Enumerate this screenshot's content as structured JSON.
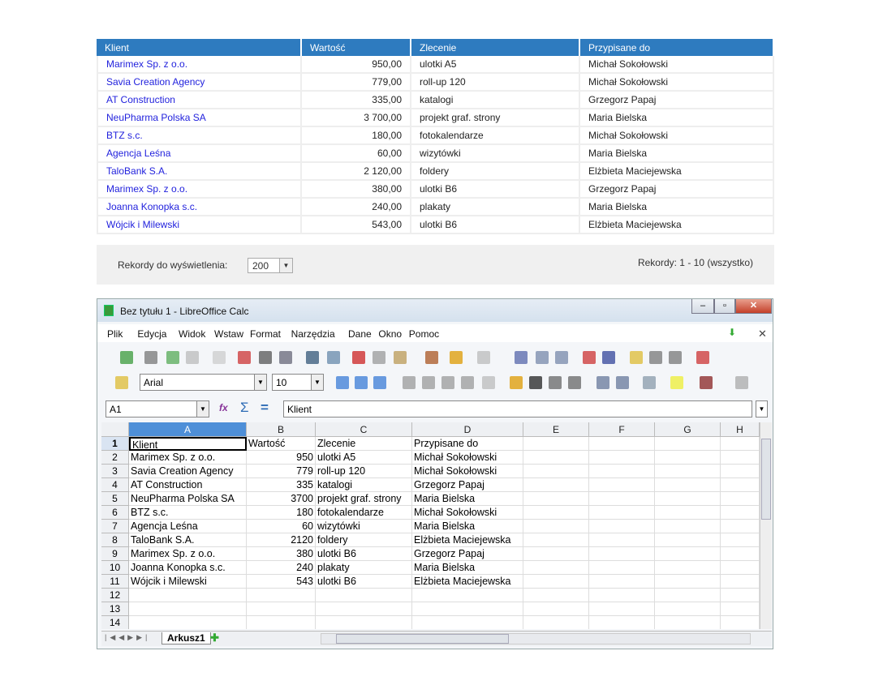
{
  "web_table": {
    "headers": [
      "Klient",
      "Wartość",
      "Zlecenie",
      "Przypisane do"
    ],
    "rows": [
      [
        "Marimex Sp. z o.o.",
        "950,00",
        "ulotki A5",
        "Michał Sokołowski"
      ],
      [
        "Savia Creation Agency",
        "779,00",
        "roll-up 120",
        "Michał Sokołowski"
      ],
      [
        "AT Construction",
        "335,00",
        "katalogi",
        "Grzegorz Papaj"
      ],
      [
        "NeuPharma Polska SA",
        "3 700,00",
        "projekt graf. strony",
        "Maria Bielska"
      ],
      [
        "BTZ s.c.",
        "180,00",
        "fotokalendarze",
        "Michał Sokołowski"
      ],
      [
        "Agencja Leśna",
        "60,00",
        "wizytówki",
        "Maria Bielska"
      ],
      [
        "TaloBank S.A.",
        "2 120,00",
        "foldery",
        "Elżbieta Maciejewska"
      ],
      [
        "Marimex Sp. z o.o.",
        "380,00",
        "ulotki B6",
        "Grzegorz Papaj"
      ],
      [
        "Joanna Konopka s.c.",
        "240,00",
        "plakaty",
        "Maria Bielska"
      ],
      [
        "Wójcik i Milewski",
        "543,00",
        "ulotki B6",
        "Elżbieta Maciejewska"
      ]
    ],
    "link_color": "#2222dd",
    "header_color": "#2e7bbf"
  },
  "footer": {
    "records_label": "Rekordy do wyświetlenia:",
    "records_value": "200",
    "records_info": "Rekordy: 1 - 10 (wszystko)"
  },
  "calc": {
    "title": "Bez tytułu 1 - LibreOffice Calc",
    "menu": [
      "Plik",
      "Edycja",
      "Widok",
      "Wstaw",
      "Format",
      "Narzędzia",
      "Dane",
      "Okno",
      "Pomoc"
    ],
    "font_name": "Arial",
    "font_size": "10",
    "cell_ref": "A1",
    "formula": "Klient",
    "columns": [
      "A",
      "B",
      "C",
      "D",
      "E",
      "F",
      "G",
      "H"
    ],
    "row_numbers": [
      "1",
      "2",
      "3",
      "4",
      "5",
      "6",
      "7",
      "8",
      "9",
      "10",
      "11",
      "12",
      "13",
      "14"
    ],
    "cells": [
      [
        "Klient",
        "Wartość",
        "Zlecenie",
        "Przypisane do"
      ],
      [
        "Marimex Sp. z o.o.",
        "950",
        "ulotki A5",
        "Michał Sokołowski"
      ],
      [
        "Savia Creation Agency",
        "779",
        "roll-up 120",
        "Michał Sokołowski"
      ],
      [
        "AT Construction",
        "335",
        "katalogi",
        "Grzegorz Papaj"
      ],
      [
        "NeuPharma Polska SA",
        "3700",
        "projekt graf. strony",
        "Maria Bielska"
      ],
      [
        "BTZ s.c.",
        "180",
        "fotokalendarze",
        "Michał Sokołowski"
      ],
      [
        "Agencja Leśna",
        "60",
        "wizytówki",
        "Maria Bielska"
      ],
      [
        "TaloBank S.A.",
        "2120",
        "foldery",
        "Elżbieta Maciejewska"
      ],
      [
        "Marimex Sp. z o.o.",
        "380",
        "ulotki B6",
        "Grzegorz Papaj"
      ],
      [
        "Joanna Konopka s.c.",
        "240",
        "plakaty",
        "Maria Bielska"
      ],
      [
        "Wójcik i Milewski",
        "543",
        "ulotki B6",
        "Elżbieta Maciejewska"
      ]
    ],
    "sheet_tab": "Arkusz1",
    "fx_label": "fx",
    "sum_label": "Σ",
    "eq_label": "="
  }
}
